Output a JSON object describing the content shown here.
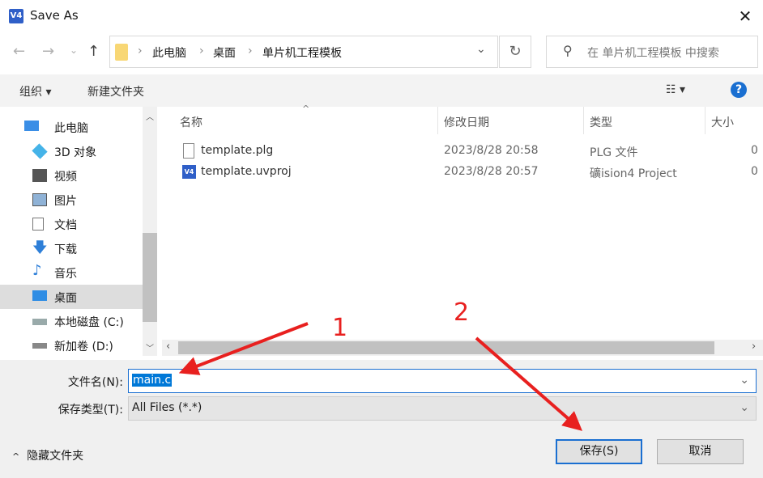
{
  "window": {
    "title": "Save As",
    "close_label": "✕"
  },
  "nav": {
    "back": "←",
    "forward": "→",
    "recent": "⌄",
    "up": "↑",
    "breadcrumb": [
      "此电脑",
      "桌面",
      "单片机工程模板"
    ],
    "refresh": "↻",
    "search_placeholder": "在 单片机工程模板 中搜索",
    "dropdown": "⌄"
  },
  "toolbar": {
    "organize": "组织 ▾",
    "new_folder": "新建文件夹",
    "view": "☷ ▾",
    "help": "?"
  },
  "sidebar": {
    "items": [
      {
        "label": "此电脑",
        "icon": "computer-icon"
      },
      {
        "label": "3D 对象",
        "icon": "3d-objects-icon"
      },
      {
        "label": "视频",
        "icon": "video-icon"
      },
      {
        "label": "图片",
        "icon": "pictures-icon"
      },
      {
        "label": "文档",
        "icon": "documents-icon"
      },
      {
        "label": "下载",
        "icon": "download-icon"
      },
      {
        "label": "音乐",
        "icon": "music-icon"
      },
      {
        "label": "桌面",
        "icon": "desktop-icon",
        "selected": true
      },
      {
        "label": "本地磁盘 (C:)",
        "icon": "drive-icon"
      },
      {
        "label": "新加卷 (D:)",
        "icon": "drive-icon"
      }
    ]
  },
  "file_list": {
    "columns": [
      "名称",
      "修改日期",
      "类型",
      "大小"
    ],
    "rows": [
      {
        "name": "template.plg",
        "date": "2023/8/28 20:58",
        "type": "PLG 文件",
        "size": "0"
      },
      {
        "name": "template.uvproj",
        "date": "2023/8/28 20:57",
        "type": "礦ision4 Project",
        "size": "0"
      }
    ]
  },
  "form": {
    "filename_label": "文件名(N):",
    "filename_value": "main.c",
    "filetype_label": "保存类型(T):",
    "filetype_value": "All Files (*.*)",
    "hide_folders": "隐藏文件夹",
    "save": "保存(S)",
    "cancel": "取消"
  },
  "annotations": {
    "label1": "1",
    "label2": "2",
    "color": "#e8201f"
  }
}
